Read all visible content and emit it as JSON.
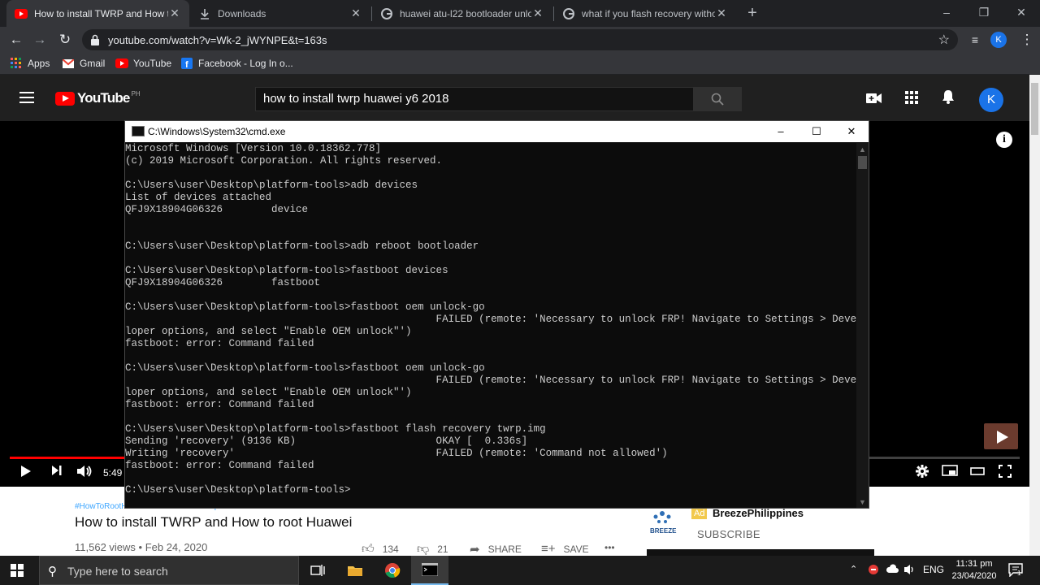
{
  "browser": {
    "tabs": [
      {
        "title": "How to install TWRP and How to",
        "favicon": "youtube-icon",
        "active": true
      },
      {
        "title": "Downloads",
        "favicon": "download-icon",
        "active": false
      },
      {
        "title": "huawei atu-l22 bootloader unlo",
        "favicon": "google-icon",
        "active": false
      },
      {
        "title": "what if you flash recovery witho",
        "favicon": "google-icon",
        "active": false
      }
    ],
    "new_tab": "+",
    "window_controls": {
      "minimize": "–",
      "restore": "❐",
      "close": "✕"
    },
    "url": "youtube.com/watch?v=Wk-2_jWYNPE&t=163s",
    "profile_initial": "K",
    "bookmarks": [
      {
        "label": "Apps",
        "icon": "apps-grid-icon"
      },
      {
        "label": "Gmail",
        "icon": "gmail-icon"
      },
      {
        "label": "YouTube",
        "icon": "youtube-icon"
      },
      {
        "label": "Facebook - Log In o...",
        "icon": "facebook-icon"
      }
    ]
  },
  "youtube": {
    "logo_text": "YouTube",
    "country": "PH",
    "search_query": "how to install twrp huawei y6 2018",
    "avatar_initial": "K",
    "player": {
      "time": "5:49",
      "progress_fraction": 0.42
    },
    "hashtags": "#HowToRootHuawei #HowToInstallTwrpHuawei",
    "video_title": "How to install TWRP and How to root Huawei",
    "meta": "11,562 views • Feb 24, 2020",
    "likes": "134",
    "dislikes": "21",
    "share": "SHARE",
    "save": "SAVE",
    "more": "•••",
    "ad": {
      "badge": "Ad",
      "channel": "BreezePhilippines",
      "subscribe": "SUBSCRIBE",
      "logo_text": "BREEZE"
    }
  },
  "cmd": {
    "title": "C:\\Windows\\System32\\cmd.exe",
    "lines": [
      "Microsoft Windows [Version 10.0.18362.778]",
      "(c) 2019 Microsoft Corporation. All rights reserved.",
      "",
      "C:\\Users\\user\\Desktop\\platform-tools>adb devices",
      "List of devices attached",
      "QFJ9X18904G06326        device",
      "",
      "",
      "C:\\Users\\user\\Desktop\\platform-tools>adb reboot bootloader",
      "",
      "C:\\Users\\user\\Desktop\\platform-tools>fastboot devices",
      "QFJ9X18904G06326        fastboot",
      "",
      "C:\\Users\\user\\Desktop\\platform-tools>fastboot oem unlock-go",
      "                                                   FAILED (remote: 'Necessary to unlock FRP! Navigate to Settings > Deve",
      "loper options, and select \"Enable OEM unlock\"')",
      "fastboot: error: Command failed",
      "",
      "C:\\Users\\user\\Desktop\\platform-tools>fastboot oem unlock-go",
      "                                                   FAILED (remote: 'Necessary to unlock FRP! Navigate to Settings > Deve",
      "loper options, and select \"Enable OEM unlock\"')",
      "fastboot: error: Command failed",
      "",
      "C:\\Users\\user\\Desktop\\platform-tools>fastboot flash recovery twrp.img",
      "Sending 'recovery' (9136 KB)                       OKAY [  0.336s]",
      "Writing 'recovery'                                 FAILED (remote: 'Command not allowed')",
      "fastboot: error: Command failed",
      "",
      "C:\\Users\\user\\Desktop\\platform-tools>"
    ]
  },
  "taskbar": {
    "search_placeholder": "Type here to search",
    "language": "ENG",
    "time": "11:31 pm",
    "date": "23/04/2020",
    "notification_count": "1"
  }
}
